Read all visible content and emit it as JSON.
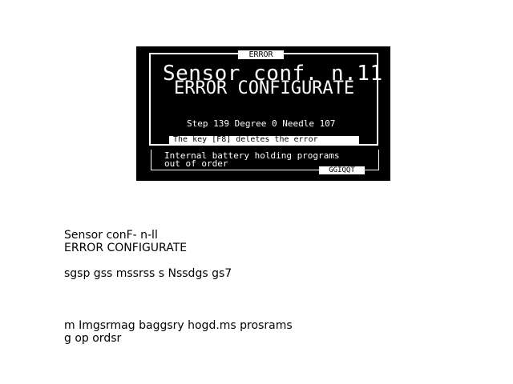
{
  "panel": {
    "tab_label": "ERROR",
    "title": "Sensor conf. n.11",
    "subtitle": "ERROR CONFIGURATE",
    "status_line": "Step 139 Degree 0    Needle 107",
    "hint": "The key [F8] deletes the error",
    "message_line1": "Internal battery holding programs",
    "message_line2": "out of order",
    "quit_label": "GGIQQT",
    "colors": {
      "background": "#000000",
      "foreground": "#ffffff"
    }
  },
  "ocr": {
    "title": "Sensor conF- n-ll",
    "subtitle": "ERROR CONFIGURATE",
    "status_line": "sgsp gss mssrss s Nssdgs gs7",
    "message_line1": "m Imgsrmag baggsry hogd.ms prosrams",
    "message_line2": "g op ordsr"
  }
}
